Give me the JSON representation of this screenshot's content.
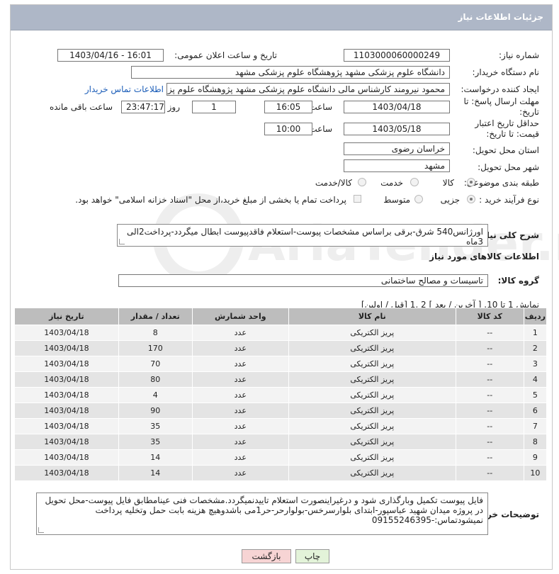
{
  "header": {
    "title": "جزئیات اطلاعات نیاز"
  },
  "fields": {
    "need_number_label": "شماره نیاز:",
    "need_number": "1103000060000249",
    "announce_label": "تاریخ و ساعت اعلان عمومی:",
    "announce_value": "1403/04/16 - 16:01",
    "buyer_label": "نام دستگاه خریدار:",
    "buyer_value": "دانشگاه علوم پزشکی مشهد   پژوهشگاه علوم پزشکی مشهد",
    "creator_label": "ایجاد کننده درخواست:",
    "creator_value": "محمود نیرومند کارشناس مالی دانشگاه علوم پزشکی مشهد   پژوهشگاه علوم پزشکی مشهد",
    "contact_link": "اطلاعات تماس خریدار",
    "deadline_label": "مهلت ارسال پاسخ: تا تاریخ:",
    "deadline_date": "1403/04/18",
    "time_label": "ساعت",
    "deadline_time": "16:05",
    "days_value": "1",
    "days_label": "روز و",
    "remaining_time": "23:47:17",
    "remaining_label": "ساعت باقی مانده",
    "validity_label": "حداقل تاریخ اعتبار قیمت: تا تاریخ:",
    "validity_date": "1403/05/18",
    "validity_time_label": "ساعت",
    "validity_time": "10:00",
    "province_label": "استان محل تحویل:",
    "province_value": "خراسان رضوی",
    "city_label": "شهر محل تحویل:",
    "city_value": "مشهد",
    "category_label": "طبقه بندی موضوعی:",
    "category_options": [
      "کالا",
      "خدمت",
      "کالا/خدمت"
    ],
    "category_selected": "کالا",
    "process_label": "نوع فرآیند خرید :",
    "process_options": [
      "جزیی",
      "متوسط"
    ],
    "process_selected": "جزیی",
    "payment_note": "پرداخت تمام یا بخشی از مبلغ خرید،از محل \"اسناد خزانه اسلامی\" خواهد بود."
  },
  "description": {
    "label": "شرح کلی نیاز:",
    "value": "اورژانس540 شرق-برقی براساس مشخصات پیوست-استعلام فاقدپیوست ابطال میگردد-پرداخت2الی 3ماه"
  },
  "goods": {
    "section_title": "اطلاعات کالاهای مورد نیاز",
    "group_label": "گروه کالا:",
    "group_value": "تاسیسات و مصالح ساختمانی",
    "pagination": "نمایش 1 تا 10. [ آخرین / بعد ] 2 ,1 [قبل / اولین]",
    "columns": [
      "ردیف",
      "کد کالا",
      "نام کالا",
      "واحد شمارش",
      "تعداد / مقدار",
      "تاریخ نیاز"
    ],
    "rows": [
      [
        "1",
        "--",
        "پریز الکتریکی",
        "عدد",
        "8",
        "1403/04/18"
      ],
      [
        "2",
        "--",
        "پریز الکتریکی",
        "عدد",
        "170",
        "1403/04/18"
      ],
      [
        "3",
        "--",
        "پریز الکتریکی",
        "عدد",
        "70",
        "1403/04/18"
      ],
      [
        "4",
        "--",
        "پریز الکتریکی",
        "عدد",
        "80",
        "1403/04/18"
      ],
      [
        "5",
        "--",
        "پریز الکتریکی",
        "عدد",
        "4",
        "1403/04/18"
      ],
      [
        "6",
        "--",
        "پریز الکتریکی",
        "عدد",
        "90",
        "1403/04/18"
      ],
      [
        "7",
        "--",
        "پریز الکتریکی",
        "عدد",
        "35",
        "1403/04/18"
      ],
      [
        "8",
        "--",
        "پریز الکتریکی",
        "عدد",
        "35",
        "1403/04/18"
      ],
      [
        "9",
        "--",
        "پریز الکتریکی",
        "عدد",
        "14",
        "1403/04/18"
      ],
      [
        "10",
        "--",
        "پریز الکتریکی",
        "عدد",
        "14",
        "1403/04/18"
      ]
    ]
  },
  "buyer_notes": {
    "label": "توضیحات خریدار:",
    "value": "فایل پیوست تکمیل وبارگذاری شود و درغیراینصورت استعلام تاییدنمیگردد.مشخصات فنی عینامطابق فایل پیوست-محل تحویل در پروژه میدان شهید عباسپور-ابتدای بلوارسرخس-بولوارحر-حر1می باشدوهیچ هزینه بابت حمل وتخلیه پرداخت نمیشودتماس:-09155246395"
  },
  "buttons": {
    "print": "چاپ",
    "back": "بازگشت"
  },
  "watermark": "AriaTender.net",
  "colors": {
    "header_bg": "#aeb7c7",
    "link": "#1b5db8",
    "back_btn": "#f7d4d4",
    "print_btn": "#e3f3d9"
  }
}
